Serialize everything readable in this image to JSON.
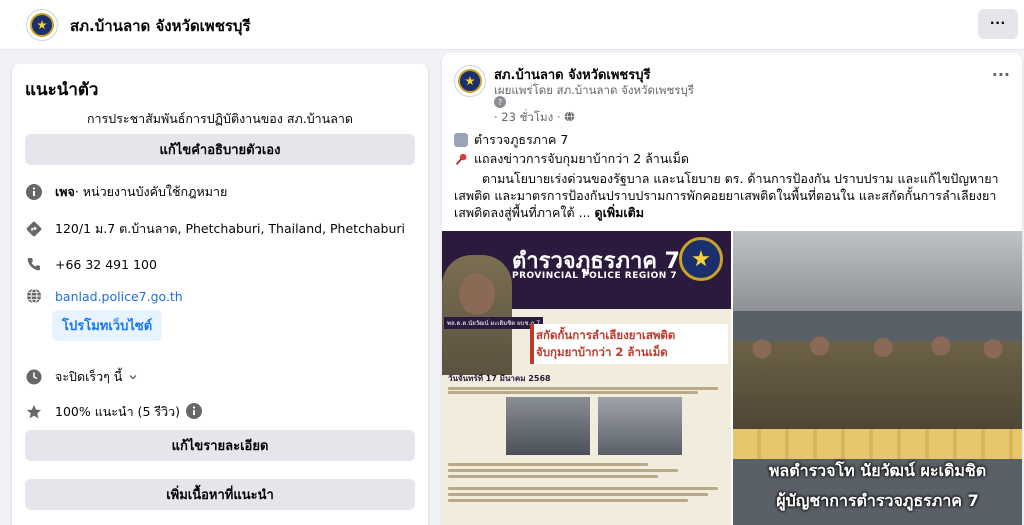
{
  "header": {
    "page_name": "สภ.บ้านลาด จังหวัดเพชรบุรี",
    "more_label": "···"
  },
  "intro": {
    "heading": "แนะนำตัว",
    "description": "การประชาสัมพันธ์การปฏิบัติงานของ สภ.บ้านลาด",
    "edit_bio_button": "แก้ไขคำอธิบายตัวเอง",
    "page_type_bold": "เพจ",
    "page_type_rest": " · หน่วยงานบังคับใช้กฎหมาย",
    "address": "120/1 ม.7 ต.บ้านลาด, Phetchaburi, Thailand, Phetchaburi",
    "phone": "+66 32 491 100",
    "website": "banlad.police7.go.th",
    "promote_button": "โปรโมทเว็บไซต์",
    "hours": "จะปิดเร็วๆ นี้",
    "rating": "100% แนะนำ (5 รีวิว)",
    "edit_details_button": "แก้ไขรายละเอียด",
    "add_featured_button": "เพิ่มเนื้อหาที่แนะนำ"
  },
  "post": {
    "author": "สภ.บ้านลาด จังหวัดเพชรบุรี",
    "published_by": "เผยแพร่โดย สภ.บ้านลาด จังหวัดเพชรบุรี",
    "help_icon": "?",
    "time": "· 23 ชั่วโมง ·",
    "line1": "ตำรวจภูธรภาค 7",
    "line2": "แถลงข่าวการจับกุมยาบ้ากว่า 2 ล้านเม็ด",
    "body": "ตามนโยบายเร่งด่วนของรัฐบาล และนโยบาย ตร. ด้านการป้องกัน ปราบปราม และแก้ไขปัญหายาเสพติด และมาตรการป้องกันปราบปรามการพักคอยยาเสพติดในพื้นที่ตอนใน และสกัดกั้นการลำเลียงยาเสพติดลงสู่พื้นที่ภาคใต้ ...",
    "see_more": "ดูเพิ่มเติม",
    "more_label": "···"
  },
  "image_left": {
    "title": "ตำรวจภูธรภาค 7",
    "subtitle": "PROVINCIAL POLICE REGION 7",
    "headline1": "สกัดกั้นการลำเลียงยาเสพติด",
    "headline2": "จับกุมยาบ้ากว่า 2 ล้านเม็ด",
    "date": "วันจันทร์ที่ 17 มีนาคม 2568",
    "officer_caption": "พล.ต.ต.นัยวัฒน์ ผะเดิมชิต ผบช.ภ.7"
  },
  "image_right": {
    "caption1": "พลตำรวจโท นัยวัฒน์ ผะเดิมชิต",
    "caption2": "ผู้บัญชาการตำรวจภูธรภาค 7"
  }
}
